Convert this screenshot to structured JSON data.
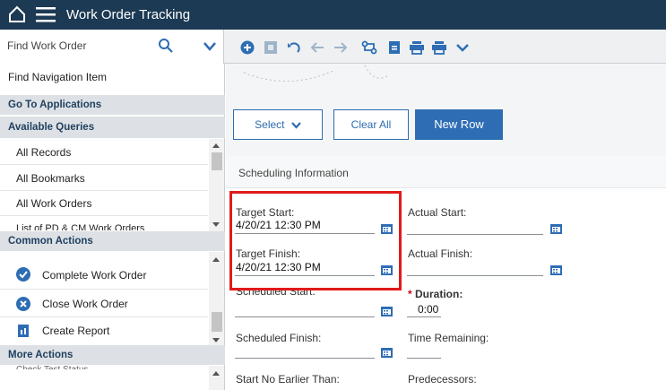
{
  "app": {
    "title": "Work Order Tracking"
  },
  "search": {
    "placeholder": "Find Work Order"
  },
  "sidebar": {
    "find_navigation": "Find Navigation Item",
    "go_to_applications": "Go To Applications",
    "available_queries": {
      "heading": "Available Queries",
      "items": [
        "All Records",
        "All Bookmarks",
        "All Work Orders",
        "List of PD & CM Work Orders"
      ]
    },
    "common_actions": {
      "heading": "Common Actions",
      "items": [
        {
          "label": "Complete Work Order",
          "icon": "check-circle-icon"
        },
        {
          "label": "Close Work Order",
          "icon": "close-circle-icon"
        },
        {
          "label": "Create Report",
          "icon": "report-icon"
        }
      ]
    },
    "more_actions": {
      "heading": "More Actions",
      "partial_item": "Check Test Status"
    }
  },
  "buttons": {
    "select": "Select",
    "clear_all": "Clear All",
    "new_row": "New Row"
  },
  "scheduling": {
    "title": "Scheduling Information",
    "target_start": {
      "label": "Target Start:",
      "value": "4/20/21 12:30 PM"
    },
    "target_finish": {
      "label": "Target Finish:",
      "value": "4/20/21 12:30 PM"
    },
    "actual_start": {
      "label": "Actual Start:",
      "value": ""
    },
    "actual_finish": {
      "label": "Actual Finish:",
      "value": ""
    },
    "scheduled_start": {
      "label": "Scheduled Start:",
      "value": ""
    },
    "scheduled_finish": {
      "label": "Scheduled Finish:",
      "value": ""
    },
    "duration": {
      "label": "Duration:",
      "value": "0:00",
      "required_marker": "*"
    },
    "time_remaining": {
      "label": "Time Remaining:",
      "value": ""
    },
    "start_no_earlier": {
      "label": "Start No Earlier Than:",
      "value": ""
    },
    "predecessors": {
      "label": "Predecessors:",
      "value": ""
    }
  },
  "colors": {
    "header": "#1c3a54",
    "accent": "#2e6db4",
    "highlight": "#e11a1a"
  }
}
